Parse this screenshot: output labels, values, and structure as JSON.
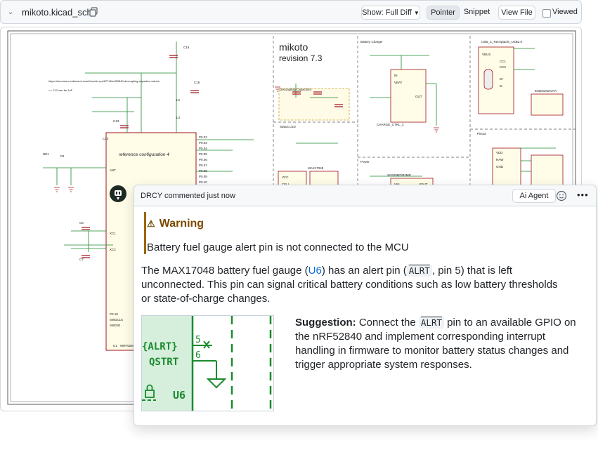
{
  "toolbar": {
    "file_name": "mikoto.kicad_sch",
    "show_label": "Show: Full Diff",
    "pointer_label": "Pointer",
    "snippet_label": "Snippet",
    "view_file_label": "View File",
    "viewed_label": "Viewed"
  },
  "schematic": {
    "title": "mikoto",
    "revision": "revision 7.3",
    "ref_config": "reference configuration 4",
    "labels": {
      "decoupling": "Decoupling Capacitors",
      "battery_charger": "Battery Charger",
      "usb_receptacle": "USB_C_Receptacle_USB2.0",
      "status_led": "Status LED",
      "power": "Power",
      "pinout": "Pinout",
      "esd": "ESD9101NUTA",
      "link_text": "https://devzone.nordicsemi.com/f/nordic-q-a/87716/nrf52840-decoupling-capacitor-values",
      "c12_note": "=> C12 can be 1uF",
      "u5": "XC6206P332MR",
      "u6": "MAX17048",
      "charge_ctrl": "CHARGE_CTRL_2",
      "u1": "U1",
      "u1_part": "WRF5284..."
    }
  },
  "comment": {
    "author_line": "DRCY commented just now",
    "agent_button": "Ai Agent",
    "more_button": "•••",
    "warning_icon": "⚠",
    "warning_title": "Warning",
    "warning_text": "Battery fuel gauge alert pin is not connected to the MCU",
    "desc_1": "The MAX17048 battery fuel gauge (",
    "desc_u6": "U6",
    "desc_2": ") has an alert pin (",
    "desc_alrt": "ALRT",
    "desc_3": ", pin 5) that is left unconnected. This pin can signal critical battery conditions such as low battery thresholds or state-of-charge changes.",
    "sugg_label": "Suggestion:",
    "sugg_1": " Connect the ",
    "sugg_alrt": "ALRT",
    "sugg_2": " pin to an available GPIO on the nRF52840 and implement corresponding interrupt handling in firmware to monitor battery status changes and trigger appropriate system responses.",
    "thumb": {
      "pin_alrt": "{ALRT}",
      "pin_qstrt": "QSTRT",
      "num_5": "5",
      "num_6": "6",
      "ref": "U6"
    }
  },
  "colors": {
    "warning": "#9a6700",
    "link": "#0969da",
    "schematic_green": "#1a8a2e",
    "thumb_fill": "#d6efdc"
  }
}
